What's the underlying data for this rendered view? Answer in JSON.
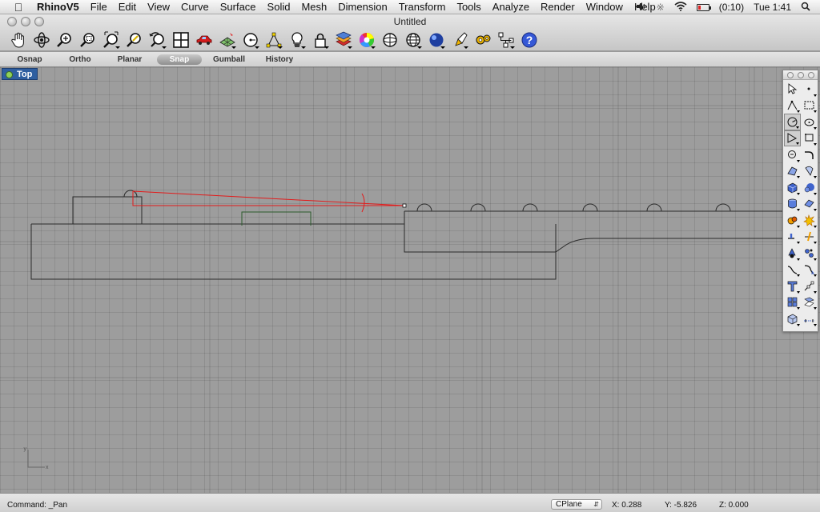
{
  "menubar": {
    "apple_icon": "apple-icon",
    "app_name": "RhinoV5",
    "items": [
      "File",
      "Edit",
      "View",
      "Curve",
      "Surface",
      "Solid",
      "Mesh",
      "Dimension",
      "Transform",
      "Tools",
      "Analyze",
      "Render",
      "Window",
      "Help"
    ],
    "battery_text": "(0:10)",
    "clock": "Tue 1:41"
  },
  "window": {
    "title": "Untitled"
  },
  "toolbar": {
    "tools": [
      "pan-icon",
      "rotate-view-icon",
      "zoom-dynamic-icon",
      "zoom-window-icon",
      "zoom-extents-icon",
      "zoom-selected-icon",
      "undo-view-icon",
      "four-viewports-icon",
      "car-render-icon",
      "grid-mesh-icon",
      "circle-icon",
      "point-snap-icon",
      "light-bulb-icon",
      "lock-icon",
      "layer-stack-icon",
      "color-wheel-icon",
      "sphere-wire-icon",
      "globe-mesh-icon",
      "render-sphere-icon",
      "highlighter-icon",
      "gear-settings-icon",
      "network-icon",
      "help-icon"
    ]
  },
  "toggles": {
    "osnap": "Osnap",
    "ortho": "Ortho",
    "planar": "Planar",
    "snap": "Snap",
    "gumball": "Gumball",
    "history": "History"
  },
  "viewport": {
    "name": "Top",
    "axis_y": "y",
    "axis_x": "x"
  },
  "palette": {
    "tools": [
      "select-arrow-icon",
      "point-icon",
      "polyline-icon",
      "rectangle-icon",
      "circle-icon",
      "arc-icon",
      "curve-icon",
      "surface-rect-icon",
      "ellipse-icon",
      "fillet-curve-icon",
      "offset-icon",
      "revolve-icon",
      "box-solid-icon",
      "sphere-solid-icon",
      "cylinder-icon",
      "extrude-icon",
      "boolean-icon",
      "explode-icon",
      "split-icon",
      "trim-icon",
      "join-icon",
      "dimension-icon",
      "text-icon",
      "transform-icon",
      "array-icon",
      "mirror-icon",
      "mesh-box-icon",
      "dim-line-icon"
    ]
  },
  "statusbar": {
    "command": "Command: _Pan",
    "cplane": "CPlane",
    "x": "X: 0.288",
    "y": "Y: -5.826",
    "z": "Z: 0.000"
  }
}
